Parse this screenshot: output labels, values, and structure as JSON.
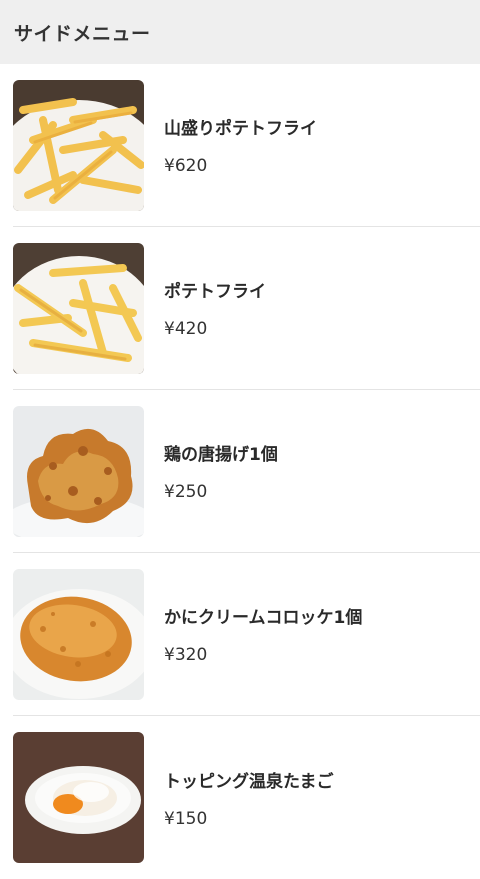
{
  "header": {
    "title": "サイドメニュー"
  },
  "items": [
    {
      "name": "山盛りポテトフライ",
      "price": "¥620"
    },
    {
      "name": "ポテトフライ",
      "price": "¥420"
    },
    {
      "name": "鶏の唐揚げ1個",
      "price": "¥250"
    },
    {
      "name": "かにクリームコロッケ1個",
      "price": "¥320"
    },
    {
      "name": "トッピング温泉たまご",
      "price": "¥150"
    }
  ]
}
